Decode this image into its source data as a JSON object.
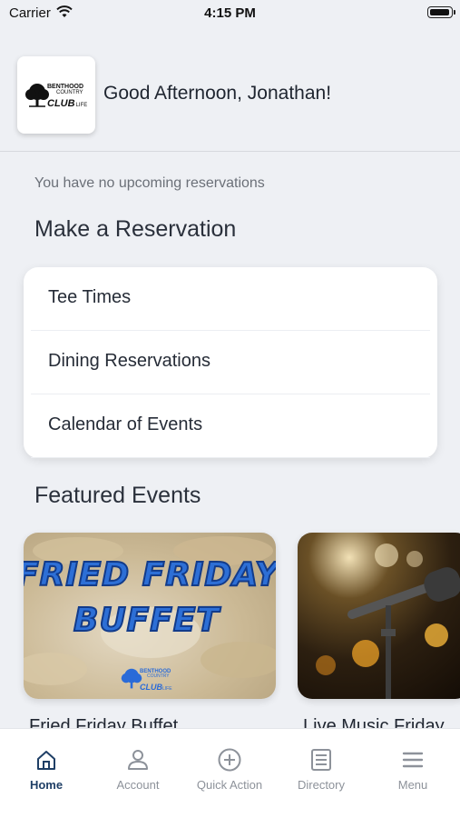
{
  "status_bar": {
    "carrier": "Carrier",
    "time": "4:15 PM"
  },
  "header": {
    "greeting": "Good Afternoon, Jonathan!",
    "logo": {
      "line1": "BENTHOOD",
      "line2": "COUNTRY",
      "line3": "CLUB",
      "line4": "LIFE"
    }
  },
  "reservations": {
    "empty_message": "You have no upcoming reservations",
    "title": "Make a Reservation",
    "items": [
      {
        "label": "Tee Times"
      },
      {
        "label": "Dining Reservations"
      },
      {
        "label": "Calendar of Events"
      }
    ]
  },
  "featured": {
    "title": "Featured Events",
    "events": [
      {
        "title": "Fried Friday Buffet",
        "image_text_line1": "FRIED FRIDAY",
        "image_text_line2": "BUFFET"
      },
      {
        "title": "Live Music Friday"
      }
    ]
  },
  "tabbar": {
    "tabs": [
      {
        "label": "Home",
        "icon": "home-icon",
        "active": true
      },
      {
        "label": "Account",
        "icon": "person-icon",
        "active": false
      },
      {
        "label": "Quick Action",
        "icon": "plus-circle-icon",
        "active": false
      },
      {
        "label": "Directory",
        "icon": "list-icon",
        "active": false
      },
      {
        "label": "Menu",
        "icon": "hamburger-icon",
        "active": false
      }
    ],
    "active_color": "#1f3f66",
    "inactive_color": "#8d929a"
  }
}
